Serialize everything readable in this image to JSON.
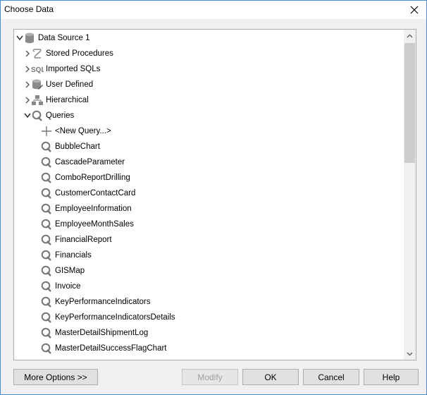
{
  "window": {
    "title": "Choose Data",
    "close_icon": "close-icon"
  },
  "tree": {
    "root": {
      "label": "Data Source 1",
      "icon": "database-icon",
      "expanded": true
    },
    "groups": [
      {
        "label": "Stored Procedures",
        "icon": "stored-procedure-icon",
        "expanded": false
      },
      {
        "label": "Imported SQLs",
        "icon": "sql-icon",
        "expanded": false
      },
      {
        "label": "User Defined",
        "icon": "user-defined-db-icon",
        "expanded": false
      },
      {
        "label": "Hierarchical",
        "icon": "hierarchy-icon",
        "expanded": false
      },
      {
        "label": "Queries",
        "icon": "query-icon",
        "expanded": true
      }
    ],
    "new_query": {
      "label": "<New Query...>",
      "icon": "plus-icon"
    },
    "queries": [
      "BubbleChart",
      "CascadeParameter",
      "ComboReportDrilling",
      "CustomerContactCard",
      "EmployeeInformation",
      "EmployeeMonthSales",
      "FinancialReport",
      "Financials",
      "GISMap",
      "Invoice",
      "KeyPerformanceIndicators",
      "KeyPerformanceIndicatorsDetails",
      "MasterDetailShipmentLog",
      "MasterDetailSuccessFlagChart"
    ]
  },
  "buttons": {
    "more_options": "More Options >>",
    "modify": "Modify",
    "ok": "OK",
    "cancel": "Cancel",
    "help": "Help"
  }
}
